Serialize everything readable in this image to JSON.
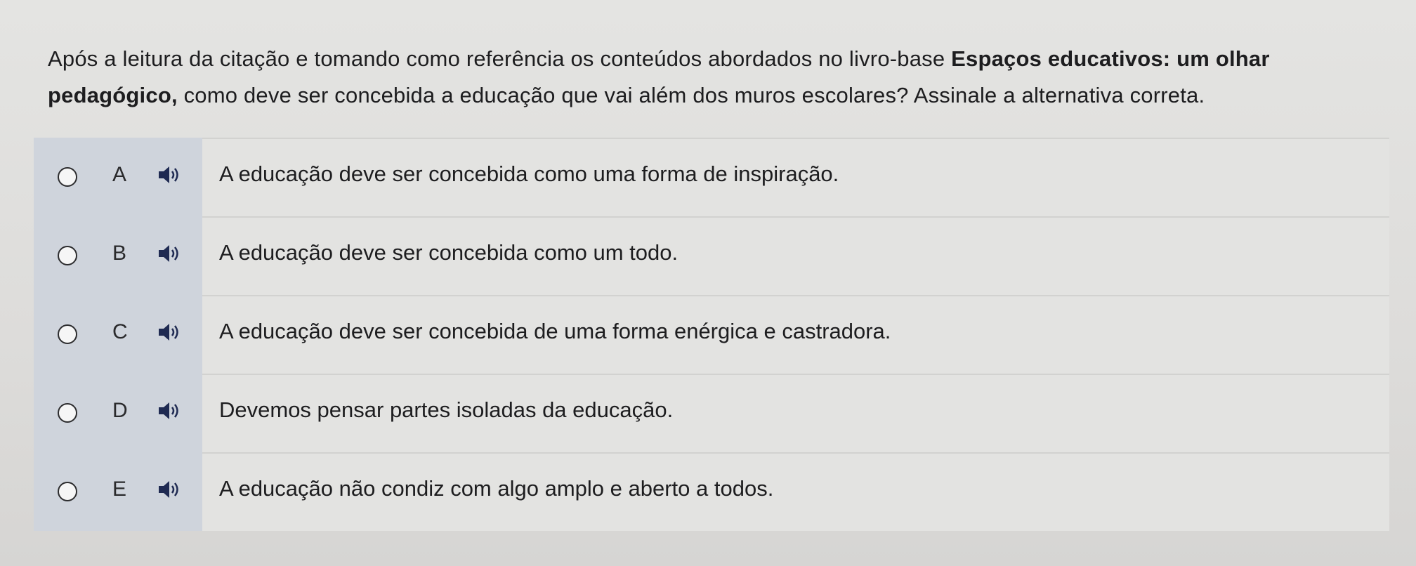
{
  "question": {
    "part1": "Após a leitura da citação e tomando como referência os conteúdos abordados no livro-base ",
    "bold": "Espaços educativos: um olhar pedagógico,",
    "part2": " como deve ser concebida a educação que vai além dos muros escolares? Assinale a alternativa correta."
  },
  "options": [
    {
      "letter": "A",
      "text": "A educação deve ser concebida como uma forma de inspiração.",
      "icon": "speaker-icon",
      "selected": false
    },
    {
      "letter": "B",
      "text": "A educação deve ser concebida como um todo.",
      "icon": "speaker-icon",
      "selected": false
    },
    {
      "letter": "C",
      "text": "A educação deve ser concebida de uma forma enérgica e castradora.",
      "icon": "speaker-icon",
      "selected": false
    },
    {
      "letter": "D",
      "text": "Devemos pensar partes isoladas da educação.",
      "icon": "speaker-icon",
      "selected": false
    },
    {
      "letter": "E",
      "text": "A educação não condiz com algo amplo e aberto a todos.",
      "icon": "speaker-icon",
      "selected": false
    }
  ],
  "colors": {
    "left_column": "#cfd4dc",
    "speaker_icon": "#1f2a52",
    "text": "#1d1d1f"
  }
}
